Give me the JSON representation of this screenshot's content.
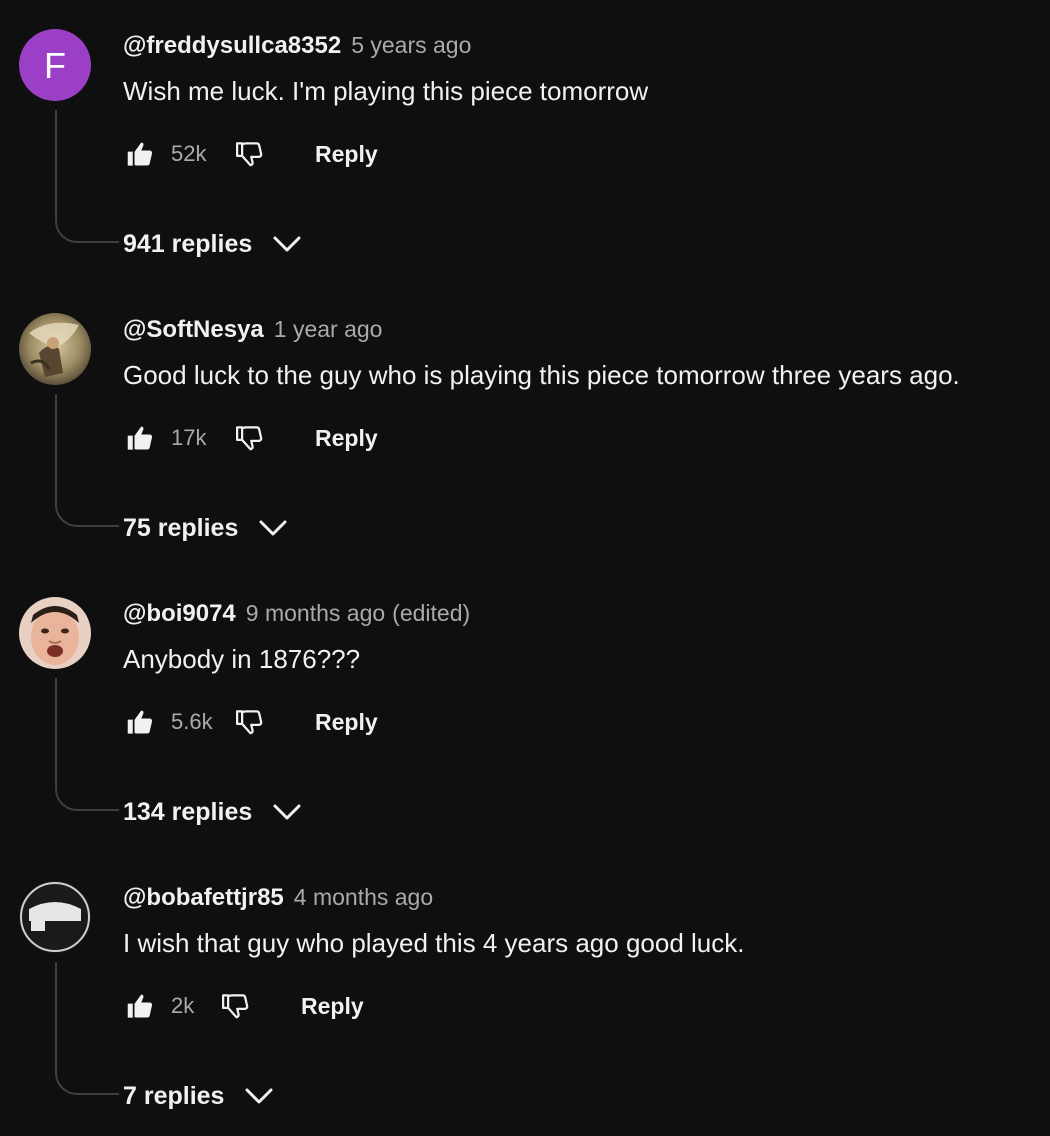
{
  "comments": [
    {
      "author": "@freddysullca8352",
      "time": "5 years ago",
      "edited": "",
      "text": "Wish me luck. I'm playing this piece tomorrow",
      "likes": "52k",
      "reply_label": "Reply",
      "replies_label": "941 replies",
      "avatar": {
        "type": "letter",
        "letter": "F",
        "color": "#9c3fc7",
        "icon": "letter-avatar"
      }
    },
    {
      "author": "@SoftNesya",
      "time": "1 year ago",
      "edited": "",
      "text": "Good luck to the guy who is playing this piece tomorrow three years ago.",
      "likes": "17k",
      "reply_label": "Reply",
      "replies_label": "75 replies",
      "avatar": {
        "type": "image",
        "icon": "painting-avatar"
      }
    },
    {
      "author": "@boi9074",
      "time": "9 months ago",
      "edited": "(edited)",
      "text": "Anybody in 1876???",
      "likes": "5.6k",
      "reply_label": "Reply",
      "replies_label": "134 replies",
      "avatar": {
        "type": "image",
        "icon": "face-photo-avatar"
      }
    },
    {
      "author": "@bobafettjr85",
      "time": "4 months ago",
      "edited": "",
      "text": "I wish that guy who played this 4 years ago good luck.",
      "likes": "2k",
      "reply_label": "Reply",
      "replies_label": "7 replies",
      "avatar": {
        "type": "image",
        "icon": "dark-shape-avatar"
      }
    }
  ],
  "icons": {
    "like": "thumbs-up-icon",
    "dislike": "thumbs-down-icon",
    "expand": "chevron-down-icon"
  },
  "colors": {
    "background": "#0f0f0f",
    "text_primary": "#f1f1f1",
    "text_secondary": "#aaaaaa",
    "thread_line": "#3f3f3f"
  }
}
